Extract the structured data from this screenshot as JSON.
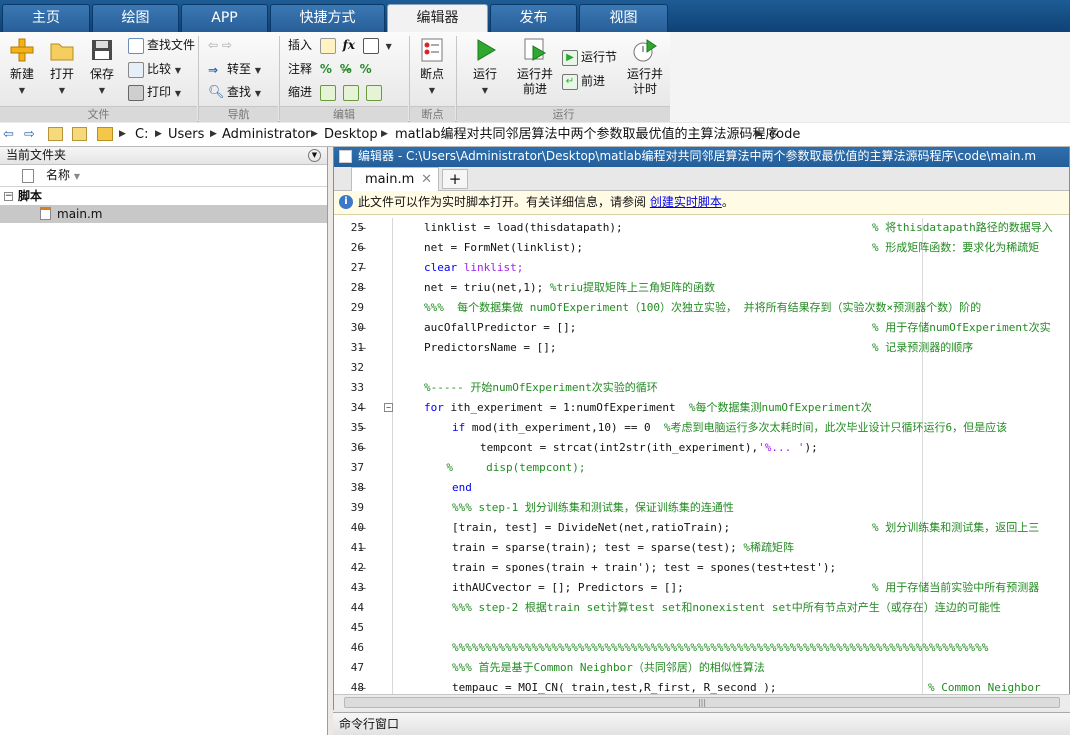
{
  "tabs": [
    "主页",
    "绘图",
    "APP",
    "快捷方式",
    "编辑器",
    "发布",
    "视图"
  ],
  "ribbon": {
    "file": {
      "new": "新建",
      "open": "打开",
      "save": "保存",
      "find_files": "查找文件",
      "compare": "比较",
      "print": "打印",
      "group": "文件"
    },
    "nav": {
      "goto": "转至",
      "find": "查找",
      "group": "导航"
    },
    "edit": {
      "insert": "插入",
      "comment": "注释",
      "indent": "缩进",
      "group": "编辑"
    },
    "breakpoints": {
      "label": "断点",
      "group": "断点"
    },
    "run": {
      "run": "运行",
      "run_advance_1": "运行并",
      "run_advance_2": "前进",
      "run_section": "运行节",
      "advance": "前进",
      "run_time_1": "运行并",
      "run_time_2": "计时",
      "group": "运行"
    }
  },
  "address": {
    "crumbs": [
      "C:",
      "Users",
      "Administrator",
      "Desktop",
      "matlab编程对共同邻居算法中两个参数取最优值的主算法源码程序",
      "code"
    ]
  },
  "left_pane": {
    "title": "当前文件夹",
    "column": "名称",
    "group": "脚本",
    "file": "main.m"
  },
  "editor": {
    "title": "编辑器 - C:\\Users\\Administrator\\Desktop\\matlab编程对共同邻居算法中两个参数取最优值的主算法源码程序\\code\\main.m",
    "tab": "main.m",
    "info_text": "此文件可以作为实时脚本打开。有关详细信息，请参阅 ",
    "info_link": "创建实时脚本",
    "info_end": "。",
    "hscroll": "|||"
  },
  "lines": [
    {
      "n": "25",
      "d": "–",
      "code": "linklist = load(thisdatapath);",
      "cm": "% 将thisdatapath路径的数据导入"
    },
    {
      "n": "26",
      "d": "–",
      "code": "net = FormNet(linklist);",
      "cm": "% 形成矩阵函数：要求化为稀疏矩"
    },
    {
      "n": "27",
      "d": "–",
      "kw": "clear ",
      "str": "linklist;"
    },
    {
      "n": "28",
      "d": "–",
      "code": "net = triu(net,1);",
      "cm2": "%triu提取矩阵上三角矩阵的函数"
    },
    {
      "n": "29",
      "d": "",
      "full_cm": "%%%  每个数据集做 numOfExperiment（100）次独立实验， 并将所有结果存到（实验次数×预测器个数）阶的"
    },
    {
      "n": "30",
      "d": "–",
      "code": "aucOfallPredictor = [];",
      "cm": "% 用于存储numOfExperiment次实"
    },
    {
      "n": "31",
      "d": "–",
      "code": "PredictorsName = [];",
      "cm": "% 记录预测器的顺序"
    },
    {
      "n": "32",
      "d": ""
    },
    {
      "n": "33",
      "d": "",
      "full_cm": "%----- 开始numOfExperiment次实验的循环"
    },
    {
      "n": "34",
      "d": "–",
      "fold": "true",
      "kw": "for ",
      "code": "ith_experiment = 1:numOfExperiment ",
      "cm2": "%每个数据集测numOfExperiment次"
    },
    {
      "n": "35",
      "d": "–",
      "indent": "1",
      "kw": "if ",
      "code": "mod(ith_experiment,10) == 0 ",
      "cm2": "%考虑到电脑运行多次太耗时间，此次毕业设计只循环运行6，但是应该"
    },
    {
      "n": "36",
      "d": "–",
      "indent": "2",
      "code": "tempcont = strcat(int2str(ith_experiment),",
      "str": "'%... '",
      "tail": ");"
    },
    {
      "n": "37",
      "d": "",
      "indent": "0.8",
      "full_cm": "%     disp(tempcont);"
    },
    {
      "n": "38",
      "d": "–",
      "indent": "1",
      "kw": "end"
    },
    {
      "n": "39",
      "d": "",
      "indent": "1",
      "full_cm": "%%% step-1 划分训练集和测试集，保证训练集的连通性"
    },
    {
      "n": "40",
      "d": "–",
      "indent": "1",
      "code": "[train, test] = DivideNet(net,ratioTrain);",
      "cm": "% 划分训练集和测试集，返回上三"
    },
    {
      "n": "41",
      "d": "–",
      "indent": "1",
      "code": "train = sparse(train); test = sparse(test);",
      "cm2": "%稀疏矩阵"
    },
    {
      "n": "42",
      "d": "–",
      "indent": "1",
      "code": "train = spones(train + train'); test = spones(test+test');"
    },
    {
      "n": "43",
      "d": "–",
      "indent": "1",
      "code": "ithAUCvector = []; Predictors = [];",
      "cm": "% 用于存储当前实验中所有预测器"
    },
    {
      "n": "44",
      "d": "",
      "indent": "1",
      "full_cm": "%%% step-2 根据train set计算test set和nonexistent set中所有节点对产生（或存在）连边的可能性"
    },
    {
      "n": "45",
      "d": ""
    },
    {
      "n": "46",
      "d": "",
      "indent": "1",
      "full_cm": "%%%%%%%%%%%%%%%%%%%%%%%%%%%%%%%%%%%%%%%%%%%%%%%%%%%%%%%%%%%%%%%%%%%%%%%%%%%%%%%%%"
    },
    {
      "n": "47",
      "d": "",
      "indent": "1",
      "full_cm": "%%% 首先是基于Common Neighbor（共同邻居）的相似性算法"
    },
    {
      "n": "48",
      "d": "–",
      "indent": "1",
      "code": "tempauc = MOI_CN( train,test,R_first, R_second );",
      "cm3": "% Common Neighbor"
    }
  ],
  "cmd": {
    "title": "命令行窗口"
  },
  "colors": {
    "accent": "#1f5f9a",
    "comment": "#228b22",
    "keyword": "#0000ff",
    "string": "#a020f0"
  }
}
